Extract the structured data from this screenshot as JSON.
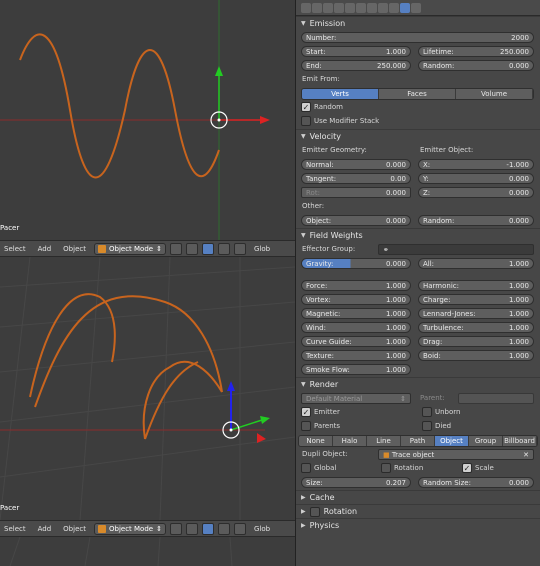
{
  "viewport_top": {
    "label": "Pacer"
  },
  "viewport_bottom": {
    "label": "Pacer"
  },
  "header_top": {
    "menus": [
      "Select",
      "Add",
      "Object"
    ],
    "mode": "Object Mode",
    "global": "Glob"
  },
  "header_bottom": {
    "menus": [
      "Select",
      "Add",
      "Object"
    ],
    "mode": "Object Mode",
    "global": "Glob"
  },
  "emission": {
    "title": "Emission",
    "number_label": "Number:",
    "number_value": "2000",
    "start_label": "Start:",
    "start_value": "1.000",
    "lifetime_label": "Lifetime:",
    "lifetime_value": "250.000",
    "end_label": "End:",
    "end_value": "250.000",
    "random_label": "Random:",
    "random_value": "0.000",
    "emit_from_label": "Emit From:",
    "emit_from_options": [
      "Verts",
      "Faces",
      "Volume"
    ],
    "random_check_label": "Random",
    "use_modifier_stack_label": "Use Modifier Stack"
  },
  "velocity": {
    "title": "Velocity",
    "emitter_geometry_label": "Emitter Geometry:",
    "emitter_object_label": "Emitter Object:",
    "normal_label": "Normal:",
    "normal_value": "0.000",
    "x_label": "X:",
    "x_value": "-1.000",
    "tangent_label": "Tangent:",
    "tangent_value": "0.00",
    "y_label": "Y:",
    "y_value": "0.000",
    "rot_label": "Rot:",
    "rot_value": "0.000",
    "z_label": "Z:",
    "z_value": "0.000",
    "other_label": "Other:",
    "object_label": "Object:",
    "object_value": "0.000",
    "random_label": "Random:",
    "random_value": "0.000"
  },
  "field_weights": {
    "title": "Field Weights",
    "effector_group_label": "Effector Group:",
    "gravity_label": "Gravity:",
    "gravity_value": "0.000",
    "all_label": "All:",
    "all_value": "1.000",
    "rows": [
      {
        "l_label": "Force:",
        "l_value": "1.000",
        "r_label": "Harmonic:",
        "r_value": "1.000"
      },
      {
        "l_label": "Vortex:",
        "l_value": "1.000",
        "r_label": "Charge:",
        "r_value": "1.000"
      },
      {
        "l_label": "Magnetic:",
        "l_value": "1.000",
        "r_label": "Lennard-Jones:",
        "r_value": "1.000"
      },
      {
        "l_label": "Wind:",
        "l_value": "1.000",
        "r_label": "Turbulence:",
        "r_value": "1.000"
      },
      {
        "l_label": "Curve Guide:",
        "l_value": "1.000",
        "r_label": "Drag:",
        "r_value": "1.000"
      },
      {
        "l_label": "Texture:",
        "l_value": "1.000",
        "r_label": "Boid:",
        "r_value": "1.000"
      }
    ],
    "smoke_flow_label": "Smoke Flow:",
    "smoke_flow_value": "1.000"
  },
  "render": {
    "title": "Render",
    "material_value": "Default Material",
    "parent_label": "Parent:",
    "emitter_label": "Emitter",
    "unborn_label": "Unborn",
    "parents_label": "Parents",
    "died_label": "Died",
    "types": [
      "None",
      "Halo",
      "Line",
      "Path",
      "Object",
      "Group",
      "Billboard"
    ],
    "dupli_object_label": "Dupli Object:",
    "dupli_object_value": "Trace object",
    "global_label": "Global",
    "rotation_label": "Rotation",
    "scale_label": "Scale",
    "size_label": "Size:",
    "size_value": "0.207",
    "random_size_label": "Random Size:",
    "random_size_value": "0.000"
  },
  "cache": {
    "title": "Cache"
  },
  "rotation": {
    "title": "Rotation"
  },
  "physics": {
    "title": "Physics"
  },
  "colors": {
    "accent": "#5680c2",
    "curve": "#c8641e"
  }
}
